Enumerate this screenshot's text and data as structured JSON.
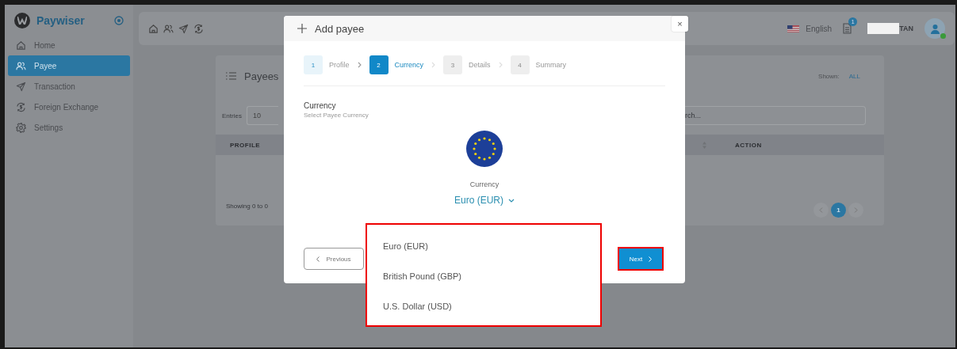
{
  "sidebar": {
    "brand": "Paywiser",
    "items": [
      {
        "label": "Home",
        "kind": "home",
        "selected": false
      },
      {
        "label": "Payee",
        "kind": "users",
        "selected": true
      },
      {
        "label": "Transaction",
        "kind": "send",
        "selected": false
      },
      {
        "label": "Foreign Exchange",
        "kind": "exchange",
        "selected": false
      },
      {
        "label": "Settings",
        "kind": "gear",
        "selected": false
      }
    ]
  },
  "topbar": {
    "language": "English",
    "notification_count": "1",
    "user_name": "TAN"
  },
  "payees_card": {
    "title": "Payees",
    "shown_label": "Shown:",
    "shown_value": "ALL",
    "entries_label": "Entries",
    "entries_value": "10",
    "search_placeholder": "rch...",
    "columns": [
      "PROFILE",
      "ACTION"
    ],
    "footer_text": "Showing 0 to 0",
    "current_page": "1"
  },
  "modal": {
    "title": "Add payee",
    "close_glyph": "×",
    "steps": [
      {
        "number": "1",
        "label": "Profile",
        "completed": true,
        "selected": false
      },
      {
        "number": "2",
        "label": "Currency",
        "completed": false,
        "selected": true
      },
      {
        "number": "3",
        "label": "Details",
        "completed": false,
        "selected": false
      },
      {
        "number": "4",
        "label": "Summary",
        "completed": false,
        "selected": false
      }
    ],
    "section_title": "Currency",
    "section_hint": "Select Payee Currency",
    "field_label": "Currency",
    "field_value": "Euro (EUR)",
    "previous_button": "Previous",
    "next_button": {
      "label": "Next",
      "highlighted": true
    }
  },
  "currency_dropdown": {
    "highlighted": true,
    "options": [
      "Euro (EUR)",
      "British Pound (GBP)",
      "U.S. Dollar (USD)"
    ]
  }
}
